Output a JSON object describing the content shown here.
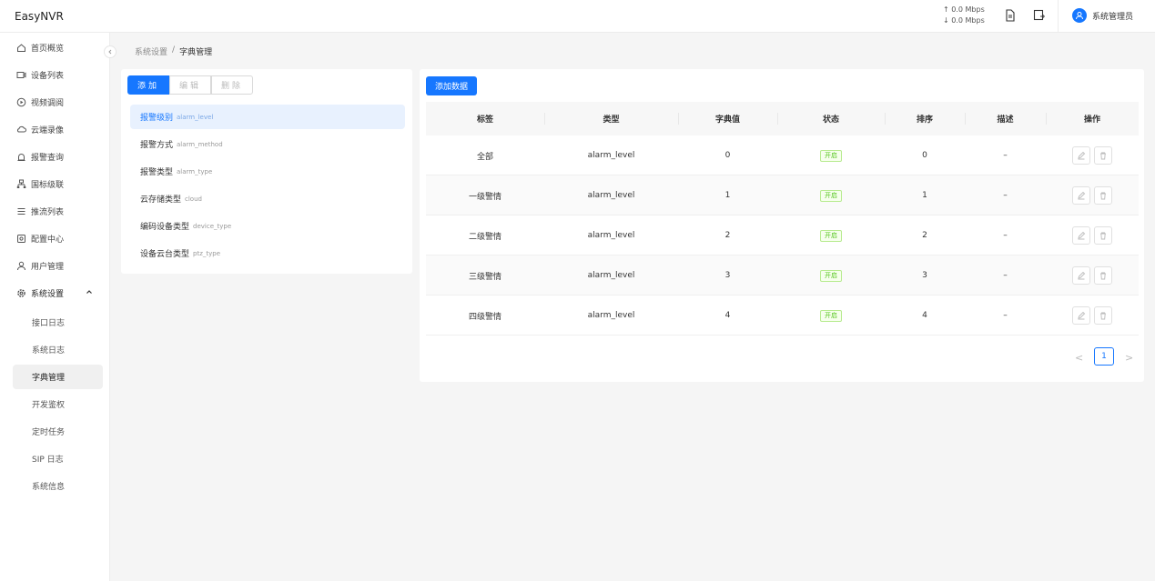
{
  "header": {
    "app_title": "EasyNVR",
    "upload_speed": "↑ 0.0 Mbps",
    "download_speed": "↓ 0.0 Mbps",
    "user_name": "系统管理员"
  },
  "sidebar": {
    "items": [
      {
        "label": "首页概览",
        "icon": "home-icon"
      },
      {
        "label": "设备列表",
        "icon": "device-icon"
      },
      {
        "label": "视频调阅",
        "icon": "play-icon"
      },
      {
        "label": "云端录像",
        "icon": "cloud-icon"
      },
      {
        "label": "报警查询",
        "icon": "alarm-icon"
      },
      {
        "label": "国标级联",
        "icon": "cascade-icon"
      },
      {
        "label": "推流列表",
        "icon": "list-icon"
      },
      {
        "label": "配置中心",
        "icon": "config-icon"
      },
      {
        "label": "用户管理",
        "icon": "user-icon"
      },
      {
        "label": "系统设置",
        "icon": "settings-icon"
      }
    ],
    "sub_items": [
      "接口日志",
      "系统日志",
      "字典管理",
      "开发鉴权",
      "定时任务",
      "SIP 日志",
      "系统信息"
    ],
    "active_sub": "字典管理"
  },
  "breadcrumb": {
    "parent": "系统设置",
    "separator": "/",
    "current": "字典管理"
  },
  "left_panel": {
    "buttons": {
      "add": "添加",
      "edit": "编辑",
      "delete": "删除"
    },
    "dict_types": [
      {
        "name": "报警级别",
        "code": "alarm_level"
      },
      {
        "name": "报警方式",
        "code": "alarm_method"
      },
      {
        "name": "报警类型",
        "code": "alarm_type"
      },
      {
        "name": "云存储类型",
        "code": "cloud"
      },
      {
        "name": "编码设备类型",
        "code": "device_type"
      },
      {
        "name": "设备云台类型",
        "code": "ptz_type"
      }
    ]
  },
  "right_panel": {
    "add_button": "添加数据",
    "columns": [
      "标签",
      "类型",
      "字典值",
      "状态",
      "排序",
      "描述",
      "操作"
    ],
    "rows": [
      {
        "label": "全部",
        "type": "alarm_level",
        "value": "0",
        "status": "开启",
        "sort": "0",
        "desc": "–"
      },
      {
        "label": "一级警情",
        "type": "alarm_level",
        "value": "1",
        "status": "开启",
        "sort": "1",
        "desc": "–"
      },
      {
        "label": "二级警情",
        "type": "alarm_level",
        "value": "2",
        "status": "开启",
        "sort": "2",
        "desc": "–"
      },
      {
        "label": "三级警情",
        "type": "alarm_level",
        "value": "3",
        "status": "开启",
        "sort": "3",
        "desc": "–"
      },
      {
        "label": "四级警情",
        "type": "alarm_level",
        "value": "4",
        "status": "开启",
        "sort": "4",
        "desc": "–"
      }
    ],
    "pagination": {
      "current_page": "1",
      "prev": "<",
      "next": ">"
    }
  },
  "colors": {
    "accent": "#1677ff",
    "status_green": "#52c41a"
  }
}
